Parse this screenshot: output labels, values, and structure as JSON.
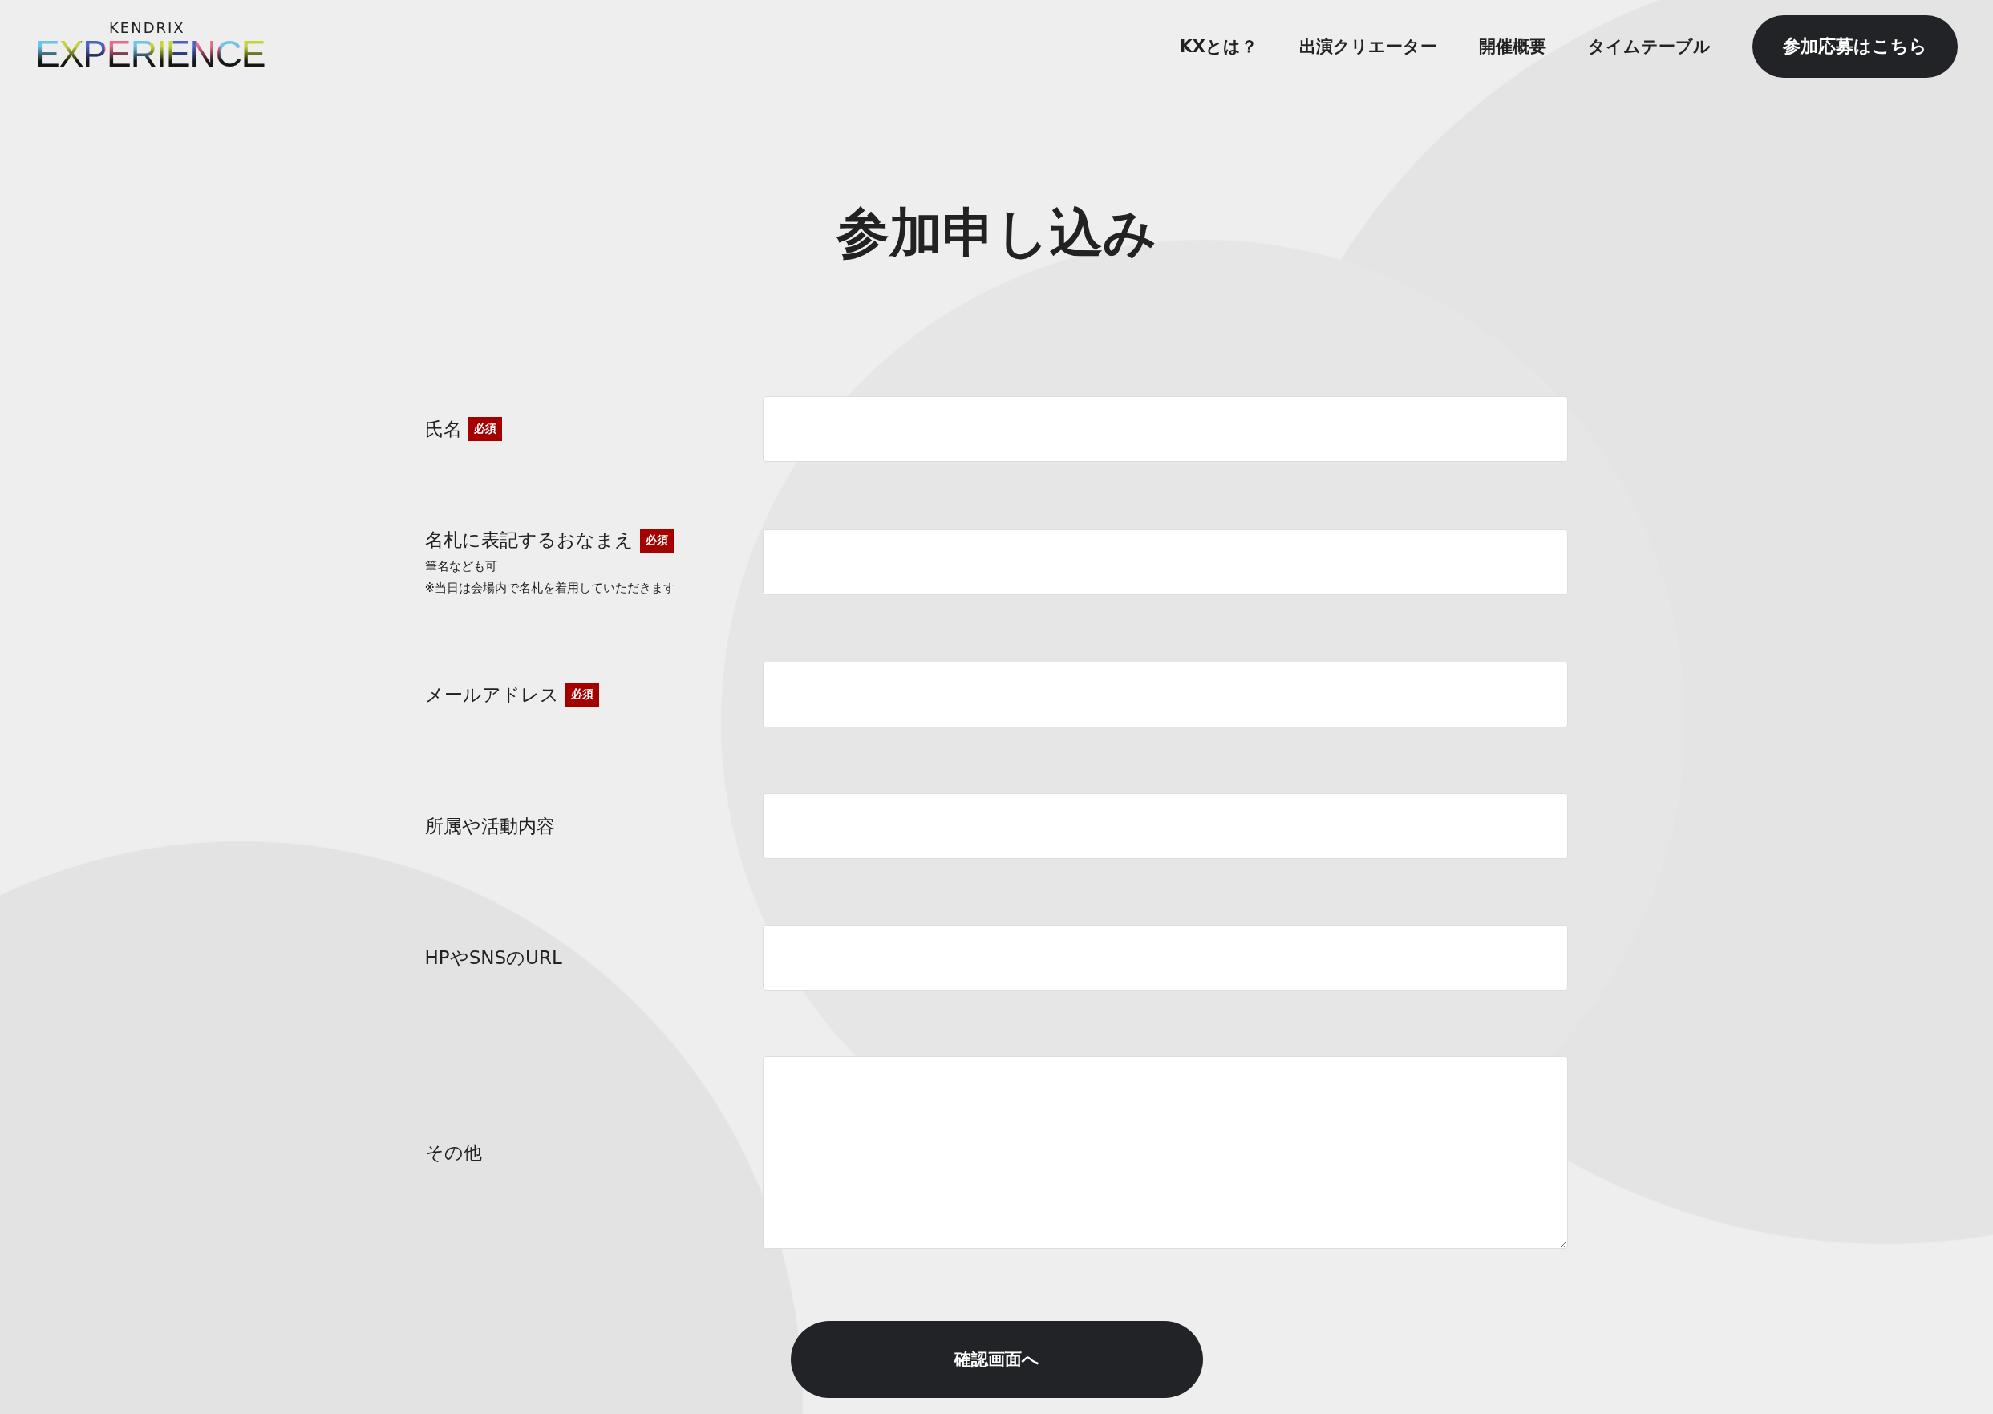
{
  "logo": {
    "overline": "KENDRIX",
    "wordmark": "EXPERIENCE"
  },
  "nav": {
    "links": [
      "KXとは？",
      "出演クリエーター",
      "開催概要",
      "タイムテーブル"
    ],
    "cta": "参加応募はこちら"
  },
  "title": "参加申し込み",
  "form": {
    "fields": [
      {
        "label": "氏名",
        "required": true,
        "badge": "必須",
        "kind": "text"
      },
      {
        "label": "名札に表記するおなまえ",
        "required": true,
        "badge": "必須",
        "kind": "text",
        "notes": [
          "筆名なども可",
          "※当日は会場内で名札を着用していただきます"
        ]
      },
      {
        "label": "メールアドレス",
        "required": true,
        "badge": "必須",
        "kind": "text"
      },
      {
        "label": "所属や活動内容",
        "required": false,
        "kind": "text"
      },
      {
        "label": "HPやSNSのURL",
        "required": false,
        "kind": "text"
      },
      {
        "label": "その他",
        "required": false,
        "kind": "textarea"
      }
    ],
    "submit": "確認画面へ"
  }
}
